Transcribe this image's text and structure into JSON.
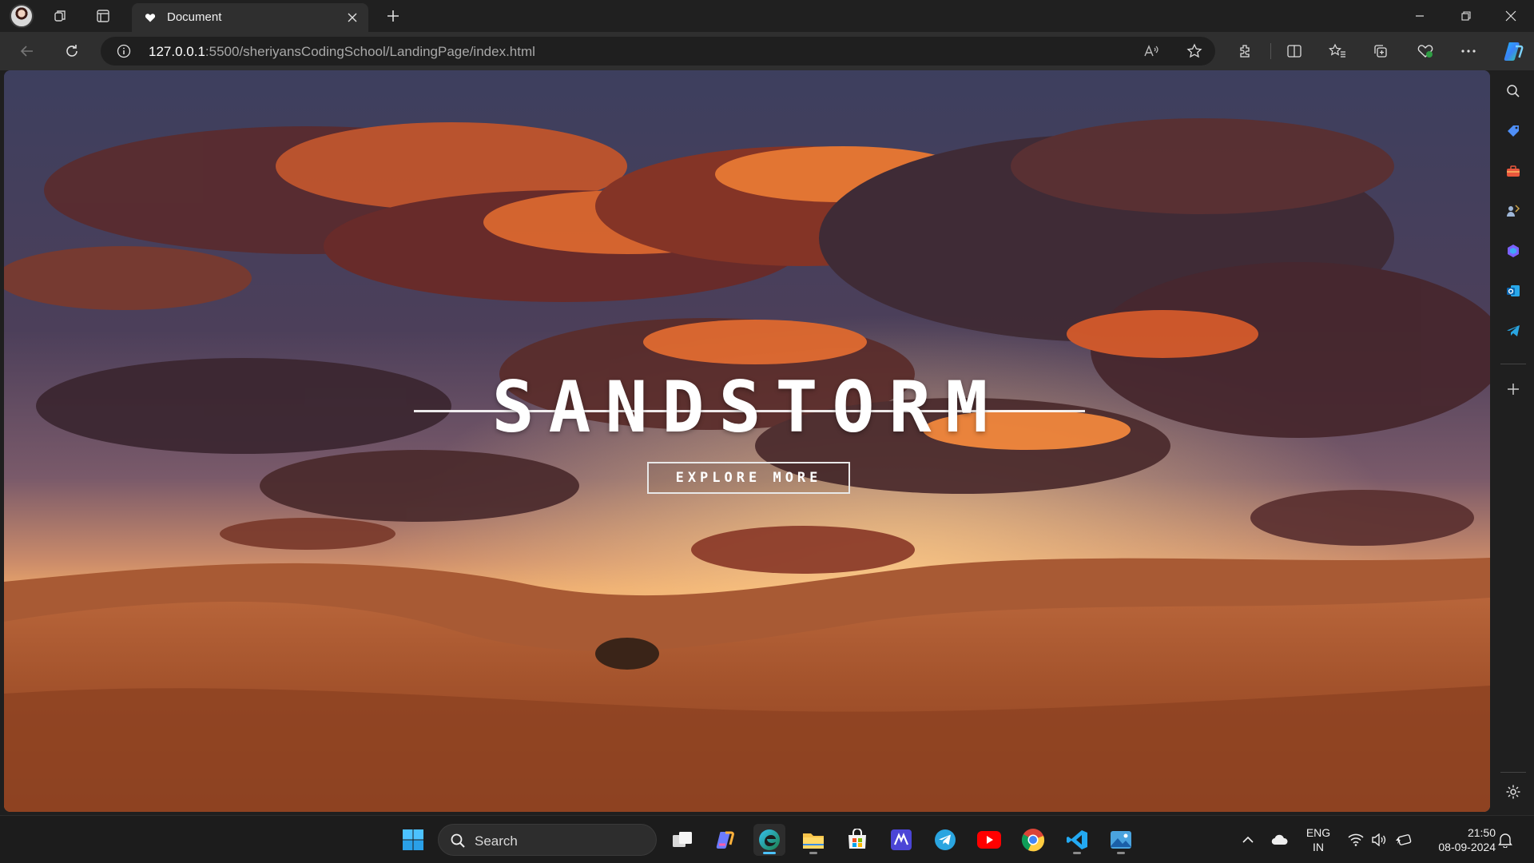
{
  "browser": {
    "tab": {
      "title": "Document",
      "favicon": "heart-icon"
    },
    "new_tab_icon": "plus-icon",
    "address": {
      "host": "127.0.0.1",
      "path": ":5500/sheriyansCodingSchool/LandingPage/index.html"
    }
  },
  "page": {
    "hero_title": "SANDSTORM",
    "explore_label": "EXPLORE MORE"
  },
  "taskbar": {
    "search_label": "Search",
    "language": {
      "line1": "ENG",
      "line2": "IN"
    },
    "clock": {
      "time": "21:50",
      "date": "08-09-2024"
    }
  },
  "colors": {
    "accent": "#4cc2ff",
    "chrome_dark": "#202020",
    "chrome_mid": "#2f2f2f"
  }
}
